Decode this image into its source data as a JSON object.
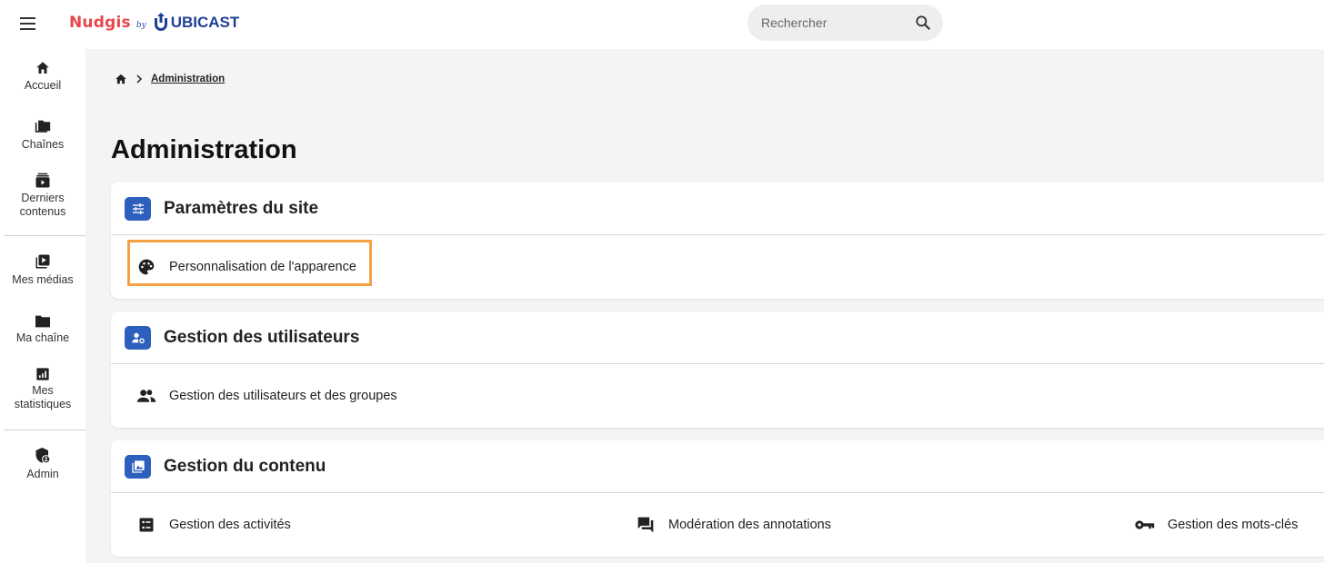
{
  "brand": {
    "part1": "Nudgis",
    "by": "by",
    "part2": "UBICAST",
    "accent": "#e8464e",
    "brand_blue": "#1f3f96"
  },
  "search": {
    "placeholder": "Rechercher"
  },
  "sidebar": {
    "items": [
      {
        "label": "Accueil",
        "icon": "home-icon"
      },
      {
        "label": "Chaînes",
        "icon": "folders-icon"
      },
      {
        "label": "Derniers contenus",
        "icon": "latest-videos-icon"
      },
      {
        "label": "Mes médias",
        "icon": "video-library-icon"
      },
      {
        "label": "Ma chaîne",
        "icon": "folder-icon"
      },
      {
        "label": "Mes statistiques",
        "icon": "stats-icon"
      },
      {
        "label": "Admin",
        "icon": "admin-shield-icon"
      }
    ]
  },
  "breadcrumb": {
    "home_icon": "home-icon",
    "current": "Administration"
  },
  "page": {
    "title": "Administration"
  },
  "sections": [
    {
      "title": "Paramètres du site",
      "icon": "tune-icon",
      "links": [
        {
          "label": "Personnalisation de l'apparence",
          "icon": "palette-icon"
        }
      ]
    },
    {
      "title": "Gestion des utilisateurs",
      "icon": "manage-accounts-icon",
      "links": [
        {
          "label": "Gestion des utilisateurs et des groupes",
          "icon": "group-icon"
        }
      ]
    },
    {
      "title": "Gestion du contenu",
      "icon": "photo-library-icon",
      "links": [
        {
          "label": "Gestion des activités",
          "icon": "checklist-icon"
        },
        {
          "label": "Modération des annotations",
          "icon": "forum-icon"
        },
        {
          "label": "Gestion des mots-clés",
          "icon": "key-icon"
        }
      ]
    }
  ],
  "colors": {
    "section_icon_bg": "#2d5fbd",
    "highlight": "#f5a043",
    "main_bg": "#f4f4f4"
  }
}
